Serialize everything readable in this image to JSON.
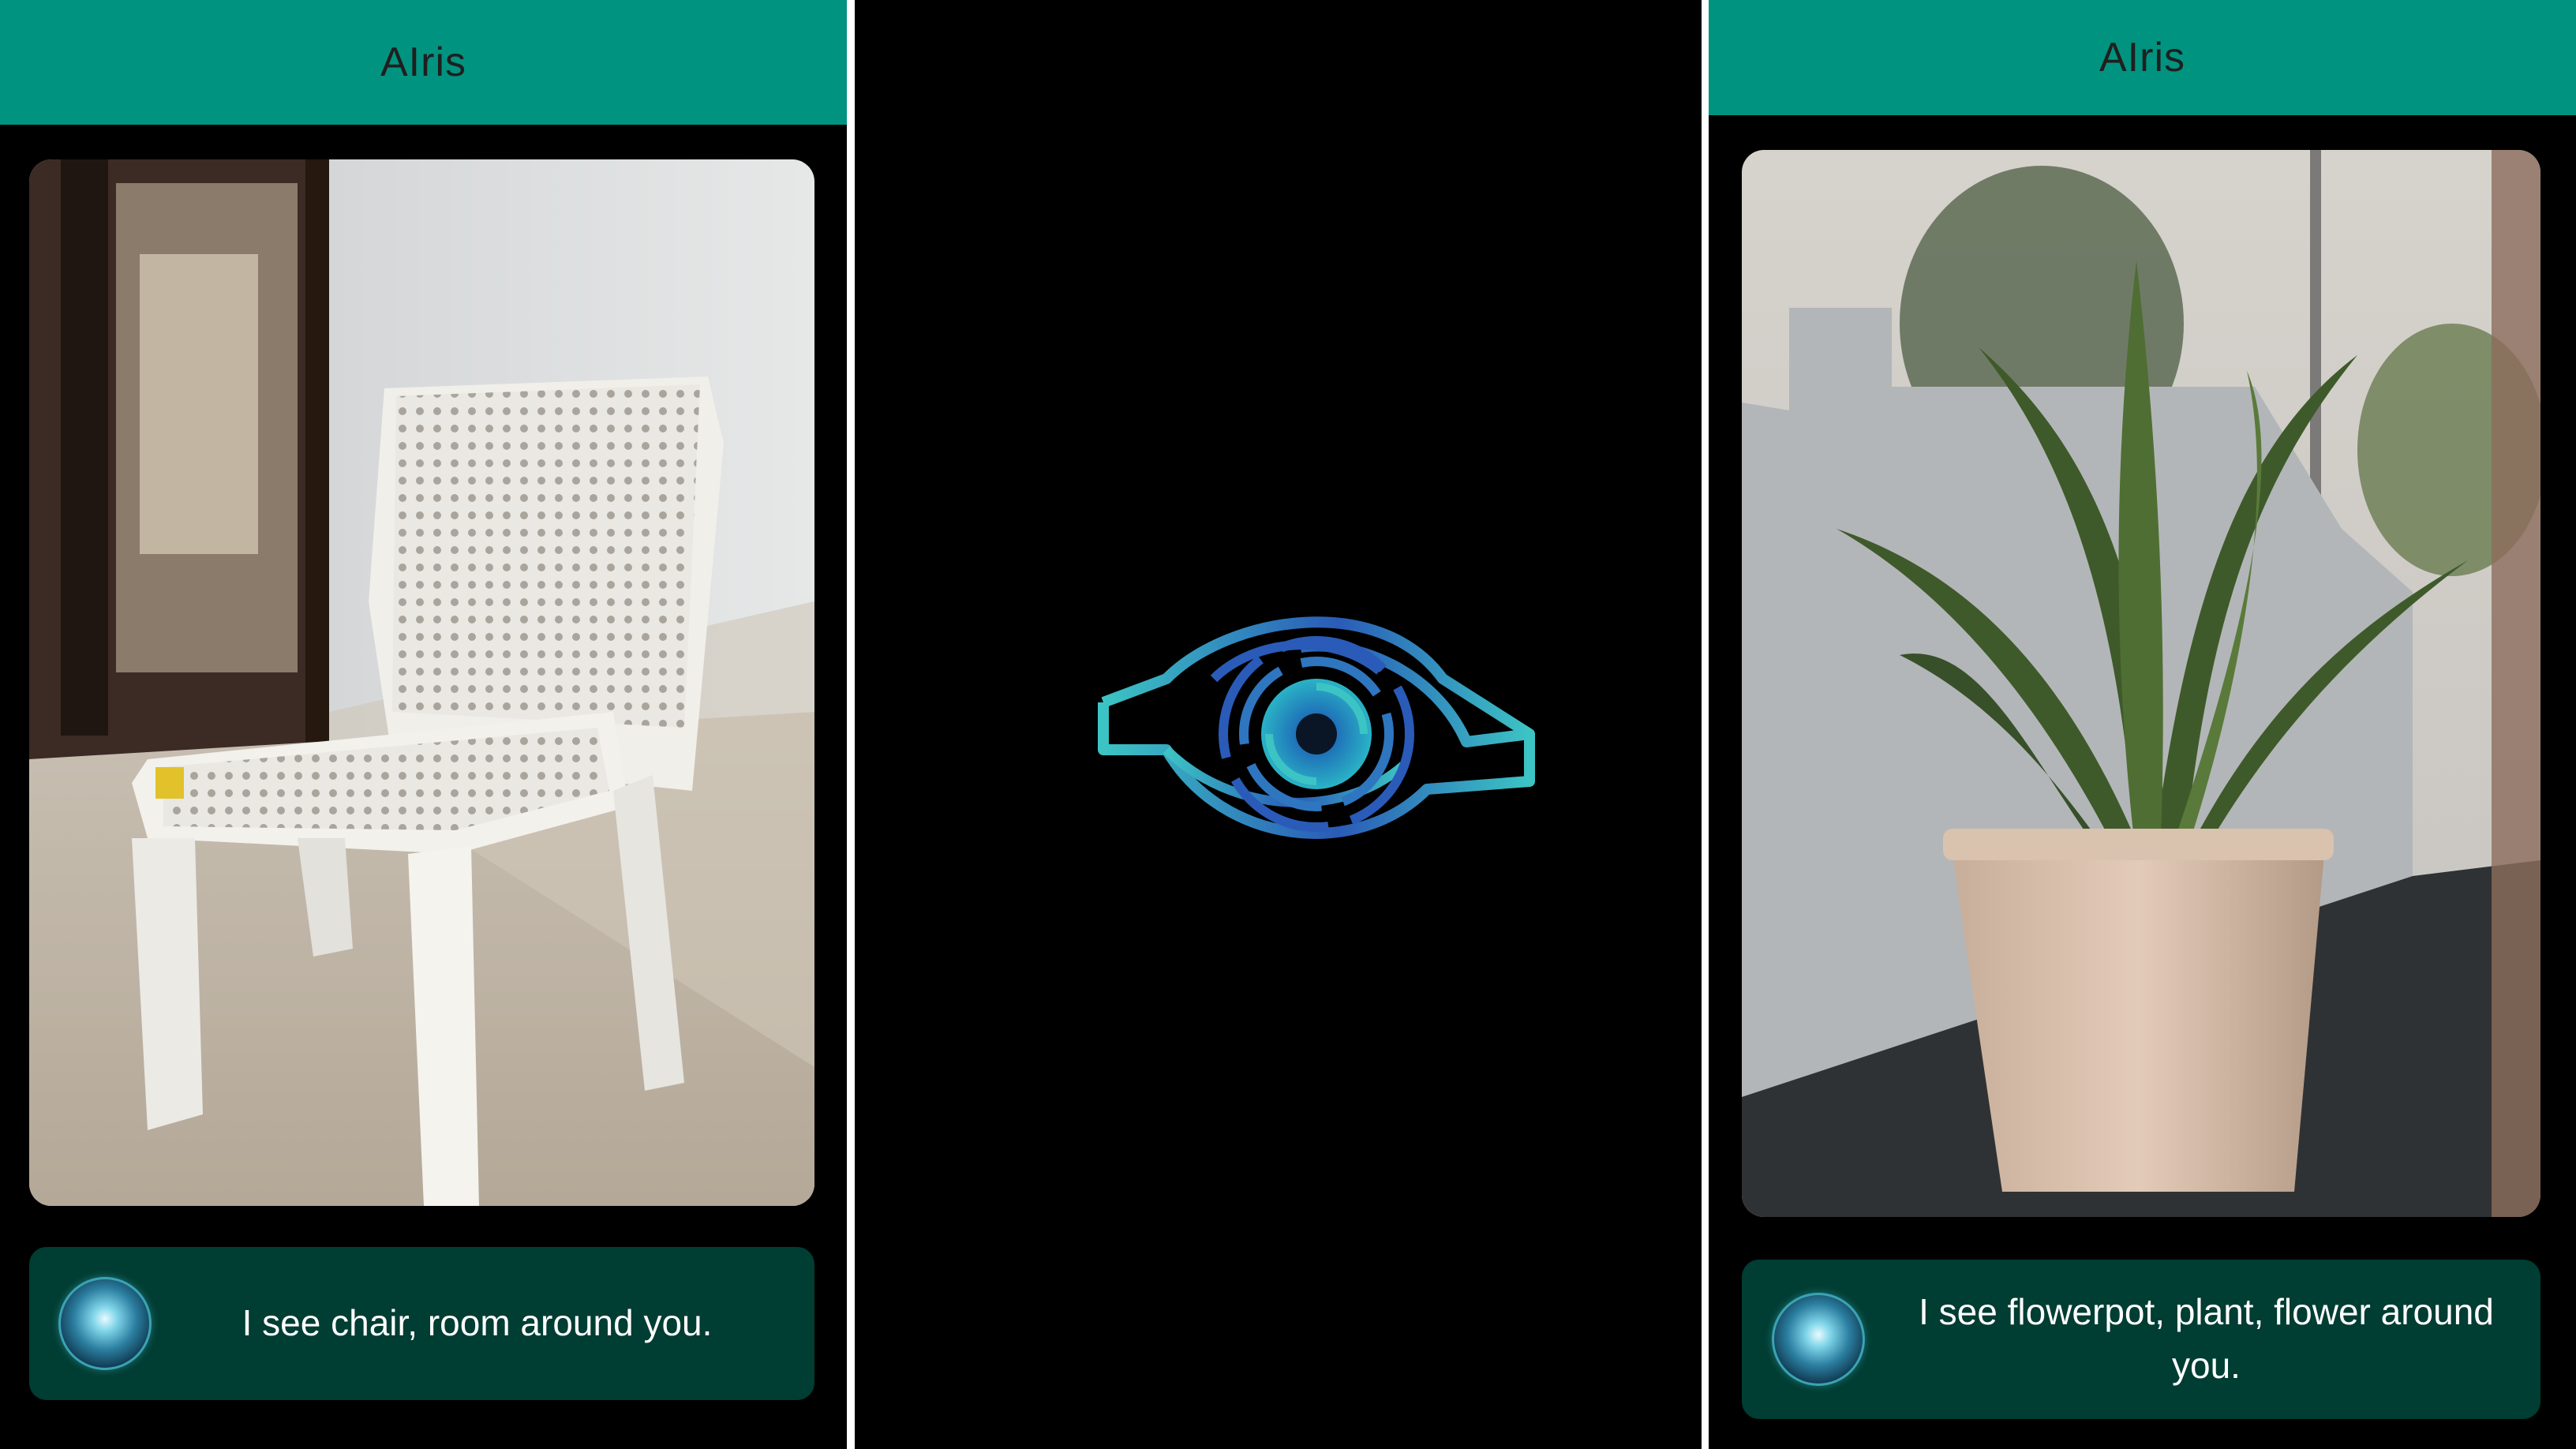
{
  "panels": [
    {
      "app_title": "AIris",
      "caption": "I see chair, room around you."
    },
    {
      "logo_icon": "eye-logo-icon"
    },
    {
      "app_title": "AIris",
      "caption": "I see flowerpot, plant, flower around you."
    }
  ],
  "colors": {
    "appbar": "#009380",
    "caption_card": "#003d33",
    "background": "#000000",
    "logo_teal": "#3cc4c4",
    "logo_blue": "#2a5bb8"
  }
}
